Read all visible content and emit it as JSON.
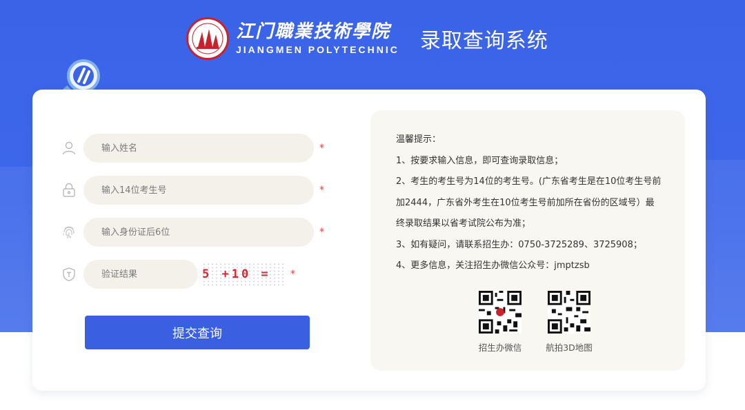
{
  "header": {
    "logo_cn": "江门職業技術學院",
    "logo_en": "JIANGMEN POLYTECHNIC",
    "system_title": "录取查询系统"
  },
  "form": {
    "name_placeholder": "输入姓名",
    "exam_no_placeholder": "输入14位考生号",
    "id_placeholder": "输入身份证后6位",
    "captcha_placeholder": "验证结果",
    "captcha_question": "5 +10 =",
    "required_mark": "*",
    "submit_label": "提交查询"
  },
  "tips": {
    "title": "温馨提示：",
    "lines": [
      "1、按要求输入信息，即可查询录取信息；",
      "2、考生的考生号为14位的考生号。(广东省考生是在10位考生号前",
      "加2444，广东省外考生在10位考生号前加所在省份的区域号）最",
      "终录取结果以省考试院公布为准；",
      "3、如有疑问，请联系招生办：0750-3725289、3725908；",
      "4、更多信息，关注招生办微信公众号：jmptzsb"
    ]
  },
  "qr_codes": [
    {
      "label": "招生办微信"
    },
    {
      "label": "航拍3D地图"
    }
  ],
  "colors": {
    "hero_blue": "#3a63e8",
    "button_blue": "#3a5fe0",
    "required_red": "#e04545",
    "input_bg": "#f4f1ea"
  },
  "icons": {
    "name_field": "user-icon",
    "exam_no_field": "lock-icon",
    "id_field": "fingerprint-icon",
    "captcha_field": "shield-icon"
  }
}
